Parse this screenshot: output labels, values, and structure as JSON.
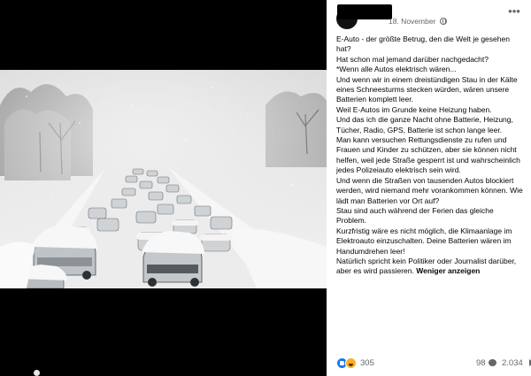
{
  "post": {
    "date": "18. November",
    "body_lines": [
      "E-Auto - der größte Betrug, den die Welt je gesehen hat?",
      "Hat schon mal jemand darüber nachgedacht?",
      "*Wenn alle Autos elektrisch wären...",
      "Und wenn wir in einem dreistündigen Stau in der Kälte eines Schneesturms stecken würden, wären unsere Batterien komplett leer.",
      "Weil E-Autos im Grunde keine Heizung haben.",
      "Und das ich die ganze Nacht ohne Batterie, Heizung, Tücher, Radio, GPS, Batterie ist schon lange leer.",
      "Man kann versuchen Rettungsdienste zu rufen und Frauen und Kinder zu schützen, aber sie können nicht helfen, weil jede Straße gesperrt ist und wahrscheinlich jedes Polizeiauto elektrisch sein wird.",
      "Und wenn die Straßen von tausenden Autos blockiert werden, wird niemand mehr vorankommen können. Wie lädt man Batterien vor Ort auf?",
      "Stau sind auch während der Ferien das gleiche Problem.",
      "Kurzfristig wäre es nicht möglich, die Klimaanlage im Elektroauto einzuschalten. Deine Batterien wären im Handumdrehen leer!"
    ],
    "last_line": "Natürlich spricht kein Politiker oder Journalist darüber, aber es wird passieren.",
    "see_less_label": "Weniger anzeigen",
    "more_label": "•••"
  },
  "stats": {
    "reactions": "305",
    "comments": "98",
    "shares": "2.034"
  },
  "icons": {
    "like": "like-icon",
    "haha": "haha-icon",
    "comment": "comment-icon",
    "share": "share-icon",
    "audience": "globe-icon"
  },
  "colors": {
    "facebook_blue": "#1877f2",
    "secondary_text": "#65676b",
    "media_background": "#000000"
  }
}
